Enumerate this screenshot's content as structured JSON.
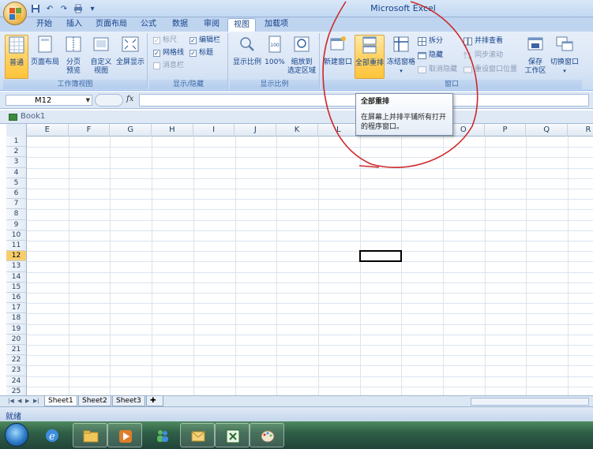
{
  "app": {
    "title": "Microsoft Excel",
    "workbook_title": "Book1"
  },
  "quick_access": {
    "save": "save-icon",
    "undo": "undo-icon",
    "redo": "redo-icon",
    "print": "print-icon",
    "customize": "customize-icon"
  },
  "tabs": [
    "开始",
    "插入",
    "页面布局",
    "公式",
    "数据",
    "审阅",
    "视图",
    "加载项"
  ],
  "active_tab": "视图",
  "ribbon": {
    "groups": {
      "workbook_views": "工作簿视图",
      "show_hide": "显示/隐藏",
      "zoom": "显示比例",
      "window": "窗口"
    },
    "workbook_views": {
      "normal": "普通",
      "page_layout": "页面布局",
      "page_break_1": "分页",
      "page_break_2": "预览",
      "custom_views_1": "自定义",
      "custom_views_2": "视图",
      "full_screen": "全屏显示"
    },
    "show_hide": {
      "ruler": "标尺",
      "gridlines": "网格线",
      "message_bar": "消息栏",
      "formula_bar": "编辑栏",
      "headings": "标题"
    },
    "zoom": {
      "zoom": "显示比例",
      "hundred": "100%",
      "zoom_sel_1": "缩放到",
      "zoom_sel_2": "选定区域"
    },
    "window": {
      "new_window": "新建窗口",
      "arrange_all": "全部重排",
      "freeze_panes": "冻结窗格",
      "split": "拆分",
      "hide": "隐藏",
      "unhide": "取消隐藏",
      "side_by_side": "并排查看",
      "sync_scroll": "同步滚动",
      "reset_position": "重设窗口位置",
      "save_workspace_1": "保存",
      "save_workspace_2": "工作区",
      "switch_windows": "切换窗口"
    }
  },
  "tooltip": {
    "title": "全部重排",
    "body": "在屏幕上并排平铺所有打开的程序窗口。"
  },
  "formula_bar": {
    "name_box": "M12",
    "fx": "fx",
    "value": ""
  },
  "grid": {
    "columns": [
      "E",
      "F",
      "G",
      "H",
      "I",
      "J",
      "K",
      "L",
      "M",
      "N",
      "O",
      "P",
      "Q",
      "R"
    ],
    "rows": [
      "1",
      "2",
      "3",
      "4",
      "5",
      "6",
      "7",
      "8",
      "9",
      "10",
      "11",
      "12",
      "13",
      "14",
      "15",
      "16",
      "17",
      "18",
      "19",
      "20",
      "21",
      "22",
      "23",
      "24",
      "25"
    ],
    "active_row": "12",
    "active_column": "M"
  },
  "sheets": [
    "Sheet1",
    "Sheet2",
    "Sheet3"
  ],
  "active_sheet": "Sheet1",
  "status": "就绪",
  "taskbar": {
    "items": [
      "start-orb",
      "ie-icon",
      "explorer-icon",
      "media-player-icon",
      "messenger-icon",
      "outlook-icon",
      "excel-icon",
      "paint-icon"
    ]
  },
  "colors": {
    "annotation_circle": "#cc2a2a",
    "active_highlight": "#ffd265"
  }
}
